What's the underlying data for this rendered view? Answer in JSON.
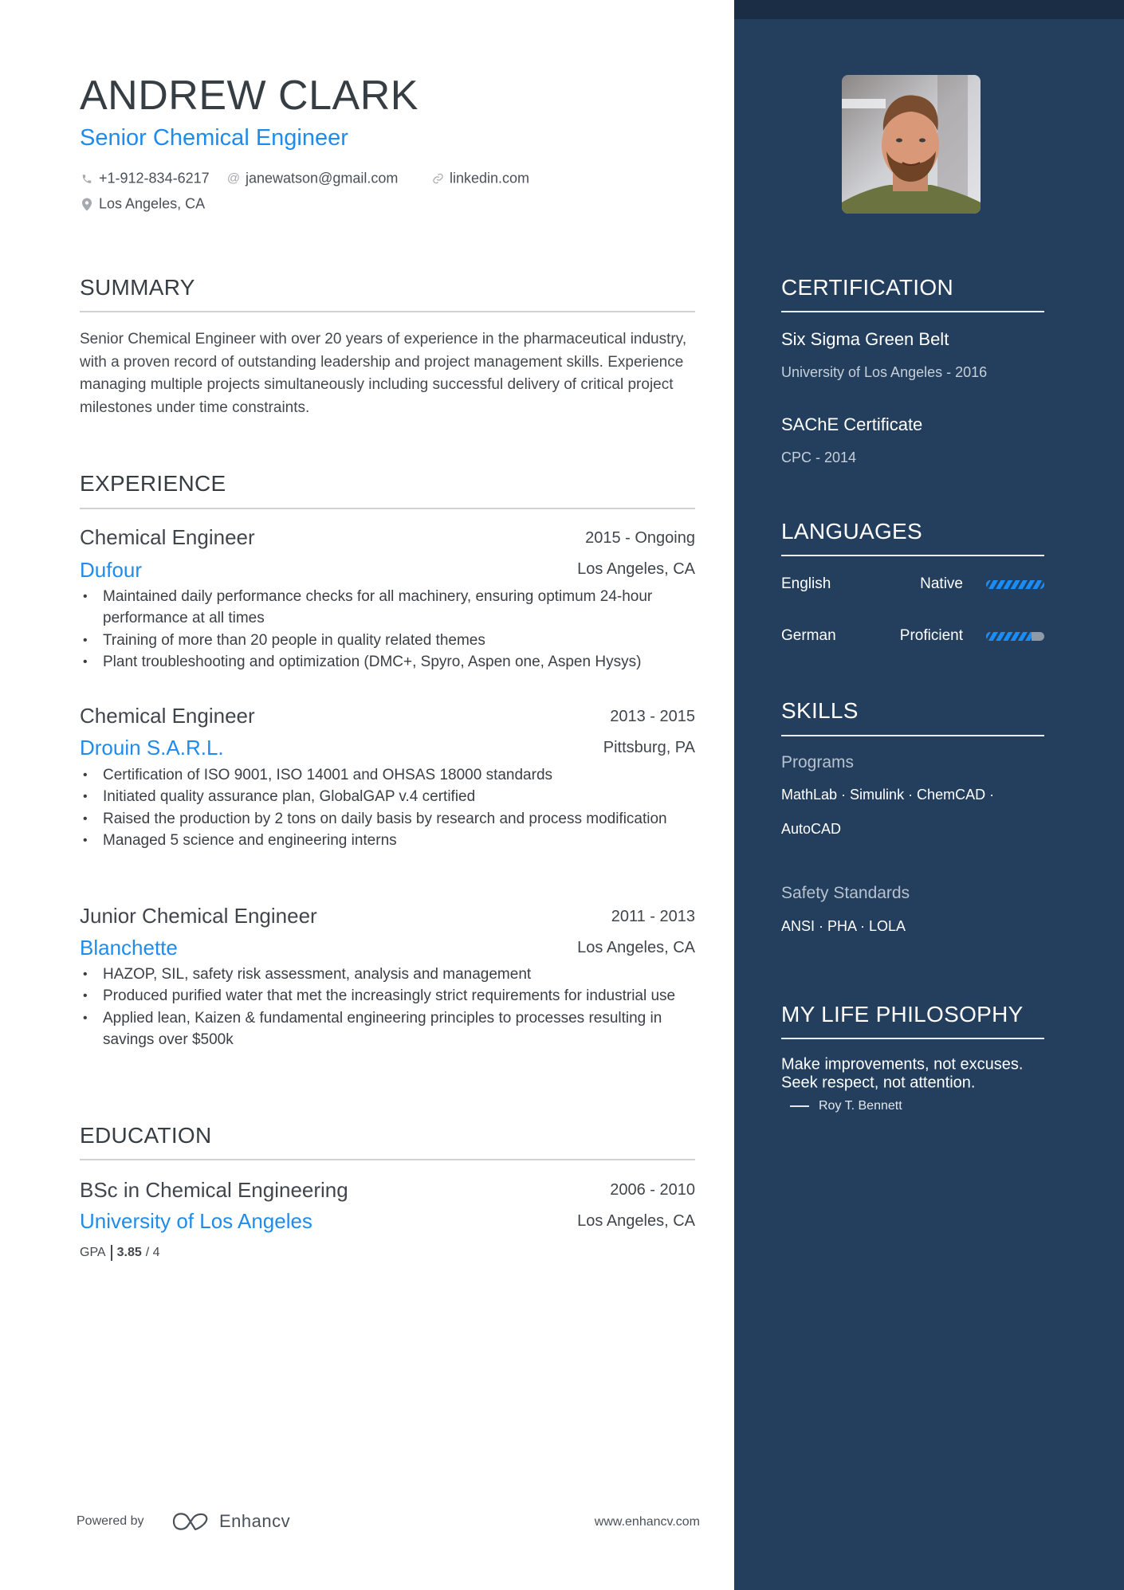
{
  "header": {
    "name": "ANDREW CLARK",
    "title": "Senior Chemical Engineer",
    "contacts": [
      {
        "icon": "phone-icon",
        "text": "+1-912-834-6217"
      },
      {
        "icon": "at-icon",
        "text": "janewatson@gmail.com"
      },
      {
        "icon": "link-icon",
        "text": "linkedin.com"
      },
      {
        "icon": "location-pin-icon",
        "text": "Los Angeles, CA"
      }
    ]
  },
  "summary": {
    "heading": "SUMMARY",
    "text": "Senior Chemical Engineer with over 20 years of experience in the pharmaceutical industry, with a proven record of outstanding leadership and project management skills.  Experience managing multiple projects simultaneously including successful delivery of critical project milestones under time constraints."
  },
  "experience": {
    "heading": "EXPERIENCE",
    "jobs": [
      {
        "role": "Chemical Engineer",
        "dates": "2015 - Ongoing",
        "company": "Dufour",
        "location": "Los Angeles, CA",
        "bullets": [
          "Maintained daily performance checks for all machinery, ensuring optimum 24-hour performance at all times",
          "Training of more than 20 people in quality related themes",
          "Plant troubleshooting and optimization (DMC+, Spyro, Aspen one, Aspen Hysys)"
        ]
      },
      {
        "role": "Chemical Engineer",
        "dates": "2013 - 2015",
        "company": "Drouin S.A.R.L.",
        "location": "Pittsburg, PA",
        "bullets": [
          "Certification of ISO 9001, ISO 14001 and OHSAS 18000 standards",
          "Initiated quality assurance plan, GlobalGAP v.4 certified",
          "Raised the production by 2 tons on daily basis by research and process modification",
          "Managed 5 science and engineering interns"
        ]
      },
      {
        "role": "Junior Chemical Engineer",
        "dates": "2011 - 2013",
        "company": "Blanchette",
        "location": "Los Angeles, CA",
        "bullets": [
          "HAZOP, SIL, safety risk assessment, analysis and management",
          "Produced purified water that met the increasingly strict requirements for industrial use",
          "Applied lean, Kaizen & fundamental engineering principles to processes resulting in savings over $500k"
        ]
      }
    ]
  },
  "education": {
    "heading": "EDUCATION",
    "degree": "BSc in Chemical Engineering",
    "dates": "2006 - 2010",
    "school": "University of Los Angeles",
    "location": "Los Angeles, CA",
    "gpa_label": "GPA",
    "gpa_value": "3.85",
    "gpa_max": "/ 4"
  },
  "footer": {
    "powered_by": "Powered by",
    "brand": "Enhancv",
    "url": "www.enhancv.com"
  },
  "sidebar": {
    "certification": {
      "heading": "CERTIFICATION",
      "items": [
        {
          "name": "Six Sigma Green Belt",
          "detail": "University of Los Angeles - 2016"
        },
        {
          "name": "SAChE Certificate",
          "detail": "CPC - 2014"
        }
      ]
    },
    "languages": {
      "heading": "LANGUAGES",
      "items": [
        {
          "name": "English",
          "level": "Native",
          "proficiency_pct": 100
        },
        {
          "name": "German",
          "level": "Proficient",
          "proficiency_pct": 78
        }
      ]
    },
    "skills": {
      "heading": "SKILLS",
      "groups": [
        {
          "category": "Programs",
          "line1": "MathLab · Simulink · ChemCAD ·",
          "line2": "AutoCAD"
        },
        {
          "category": "Safety Standards",
          "line1": "ANSI · PHA ·  LOLA"
        }
      ]
    },
    "philosophy": {
      "heading": "MY LIFE PHILOSOPHY",
      "quote_line1": "Make improvements, not excuses.",
      "quote_line2": "Seek respect, not attention.",
      "author": "Roy T. Bennett"
    }
  },
  "colors": {
    "accent": "#1f8ceb",
    "sidebar_bg": "#233f5d",
    "sidebar_top": "#1b2d45"
  }
}
